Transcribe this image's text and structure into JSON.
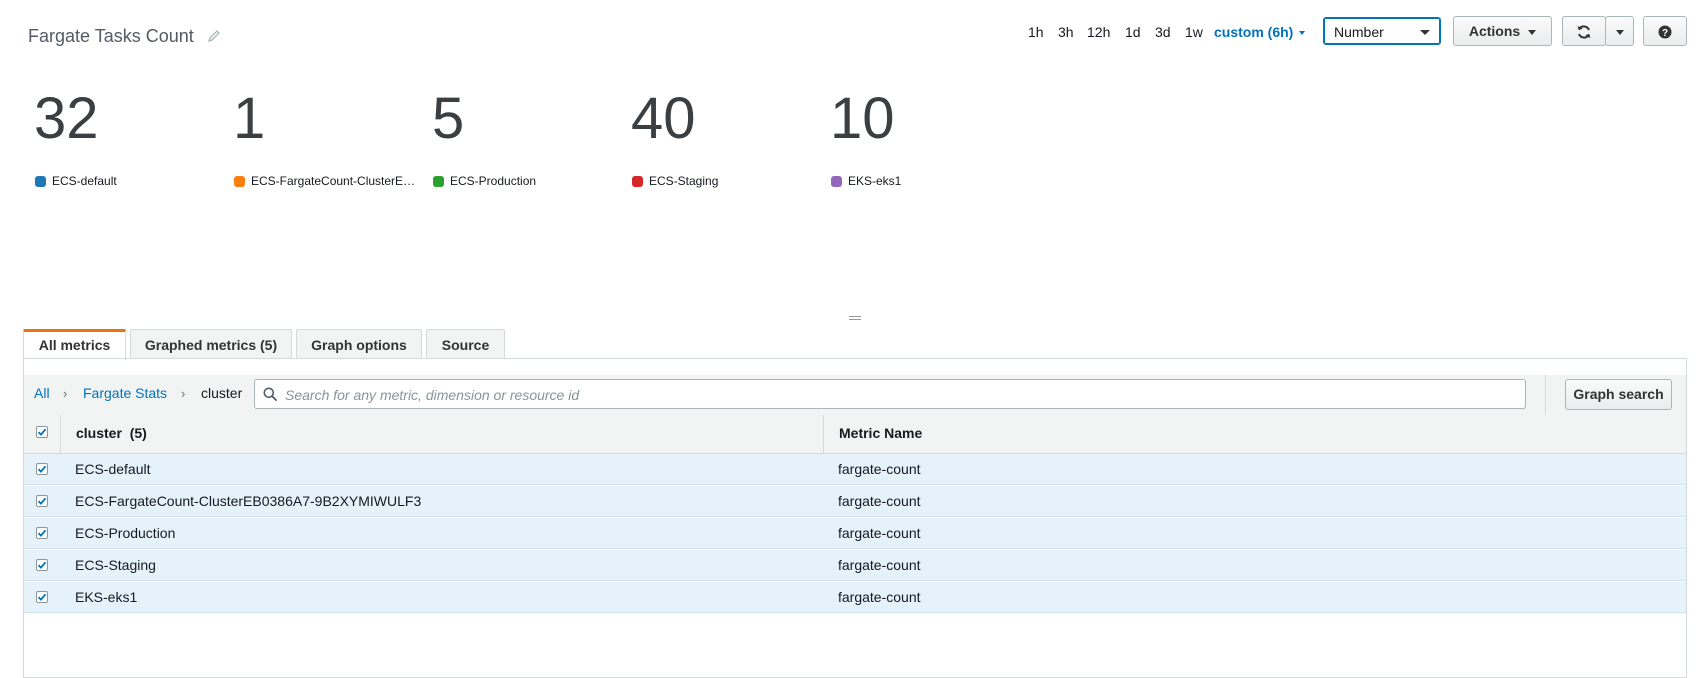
{
  "header": {
    "title": "Fargate Tasks Count",
    "periods": [
      "1h",
      "3h",
      "12h",
      "1d",
      "3d",
      "1w"
    ],
    "custom_period": "custom (6h)",
    "view_select": "Number",
    "actions_label": "Actions"
  },
  "widgets": [
    {
      "value": "32",
      "label": "ECS-default",
      "color": "#1f77b4"
    },
    {
      "value": "1",
      "label": "ECS-FargateCount-ClusterEB0386A7-9B2XYMIWULF3",
      "color": "#ff7f0e"
    },
    {
      "value": "5",
      "label": "ECS-Production",
      "color": "#2ca02c"
    },
    {
      "value": "40",
      "label": "ECS-Staging",
      "color": "#d62728"
    },
    {
      "value": "10",
      "label": "EKS-eks1",
      "color": "#9467bd"
    }
  ],
  "tabs": [
    {
      "label": "All metrics",
      "active": true
    },
    {
      "label": "Graphed metrics (5)",
      "active": false
    },
    {
      "label": "Graph options",
      "active": false
    },
    {
      "label": "Source",
      "active": false
    }
  ],
  "breadcrumb": {
    "all": "All",
    "namespace": "Fargate Stats",
    "current": "cluster"
  },
  "search": {
    "placeholder": "Search for any metric, dimension or resource id",
    "graph_search_label": "Graph search"
  },
  "table": {
    "col1_header": "cluster",
    "col1_count": "(5)",
    "col2_header": "Metric Name",
    "rows": [
      {
        "cluster": "ECS-default",
        "metric": "fargate-count",
        "checked": true
      },
      {
        "cluster": "ECS-FargateCount-ClusterEB0386A7-9B2XYMIWULF3",
        "metric": "fargate-count",
        "checked": true
      },
      {
        "cluster": "ECS-Production",
        "metric": "fargate-count",
        "checked": true
      },
      {
        "cluster": "ECS-Staging",
        "metric": "fargate-count",
        "checked": true
      },
      {
        "cluster": "EKS-eks1",
        "metric": "fargate-count",
        "checked": true
      }
    ]
  },
  "colors": {
    "link": "#0073bb",
    "active_tab_accent": "#ec7211",
    "row_selected": "#e6f2fa"
  }
}
